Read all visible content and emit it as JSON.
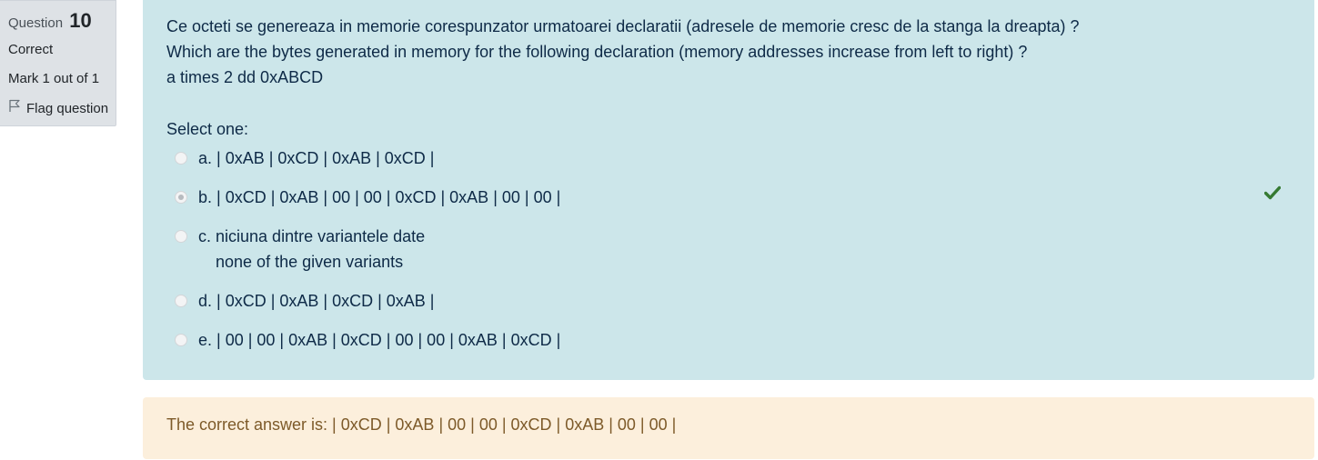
{
  "info": {
    "question_label": "Question",
    "question_number": "10",
    "state": "Correct",
    "grade": "Mark 1 out of 1",
    "flag_label": "Flag question",
    "flag_icon": "flag-outline-icon"
  },
  "question": {
    "text_lines": [
      "Ce octeti se genereaza in memorie corespunzator urmatoarei declaratii (adresele de memorie cresc de la stanga la dreapta) ?",
      "Which are the bytes generated in memory for the following declaration (memory addresses increase from left to right) ?",
      "a times 2 dd 0xABCD"
    ],
    "prompt": "Select one:",
    "options": [
      {
        "letter": "a.",
        "text": "| 0xAB | 0xCD | 0xAB | 0xCD |",
        "text2": "",
        "selected": false
      },
      {
        "letter": "b.",
        "text": "| 0xCD | 0xAB | 00 | 00 | 0xCD | 0xAB | 00 | 00 |",
        "text2": "",
        "selected": true
      },
      {
        "letter": "c.",
        "text": "niciuna dintre variantele date",
        "text2": "none of the given variants",
        "selected": false
      },
      {
        "letter": "d.",
        "text": "| 0xCD | 0xAB | 0xCD | 0xAB |",
        "text2": "",
        "selected": false
      },
      {
        "letter": "e.",
        "text": "| 00 | 00 | 0xAB | 0xCD | 00 | 00 | 0xAB | 0xCD |",
        "text2": "",
        "selected": false
      }
    ],
    "correct_icon": "check-icon",
    "correct_icon_color": "#357a32"
  },
  "feedback": {
    "right_answer": "The correct answer is: | 0xCD | 0xAB | 00 | 00 | 0xCD | 0xAB | 00 | 00 |"
  },
  "colors": {
    "info_bg": "#dee2e6",
    "formulation_bg": "#cce6ea",
    "feedback_bg": "#fcefdc",
    "feedback_text": "#7d5a29"
  }
}
